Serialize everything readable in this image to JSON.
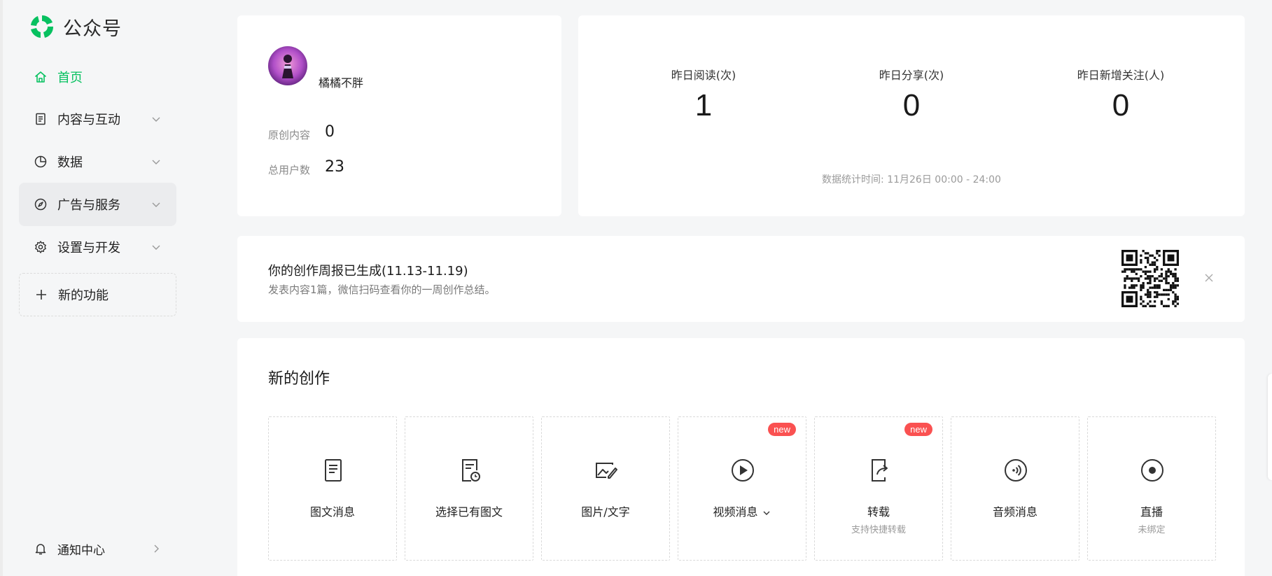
{
  "brand": {
    "name": "公众号",
    "accent": "#07c160"
  },
  "sidebar": {
    "items": [
      {
        "label": "首页",
        "icon": "home-icon",
        "active": true
      },
      {
        "label": "内容与互动",
        "icon": "document-icon"
      },
      {
        "label": "数据",
        "icon": "pie-chart-icon"
      },
      {
        "label": "广告与服务",
        "icon": "compass-icon"
      },
      {
        "label": "设置与开发",
        "icon": "gear-icon"
      }
    ],
    "new_feature": "新的功能",
    "notification": "通知中心"
  },
  "profile": {
    "name": "橘橘不胖",
    "original_label": "原创内容",
    "original_value": "0",
    "users_label": "总用户数",
    "users_value": "23"
  },
  "stats": {
    "items": [
      {
        "label": "昨日阅读(次)",
        "value": "1"
      },
      {
        "label": "昨日分享(次)",
        "value": "0"
      },
      {
        "label": "昨日新增关注(人)",
        "value": "0"
      }
    ],
    "time": "数据统计时间: 11月26日 00:00 - 24:00"
  },
  "report": {
    "title": "你的创作周报已生成(11.13-11.19)",
    "subtitle": "发表内容1篇，微信扫码查看你的一周创作总结。"
  },
  "create": {
    "title": "新的创作",
    "tiles": [
      {
        "label": "图文消息",
        "icon": "article-icon"
      },
      {
        "label": "选择已有图文",
        "icon": "select-article-icon"
      },
      {
        "label": "图片/文字",
        "icon": "image-text-icon"
      },
      {
        "label": "视频消息",
        "icon": "video-icon",
        "badge": "new",
        "dropdown": true
      },
      {
        "label": "转载",
        "sub": "支持快捷转载",
        "icon": "repost-icon",
        "badge": "new"
      },
      {
        "label": "音频消息",
        "icon": "audio-icon"
      },
      {
        "label": "直播",
        "sub": "未绑定",
        "icon": "live-icon"
      }
    ]
  }
}
